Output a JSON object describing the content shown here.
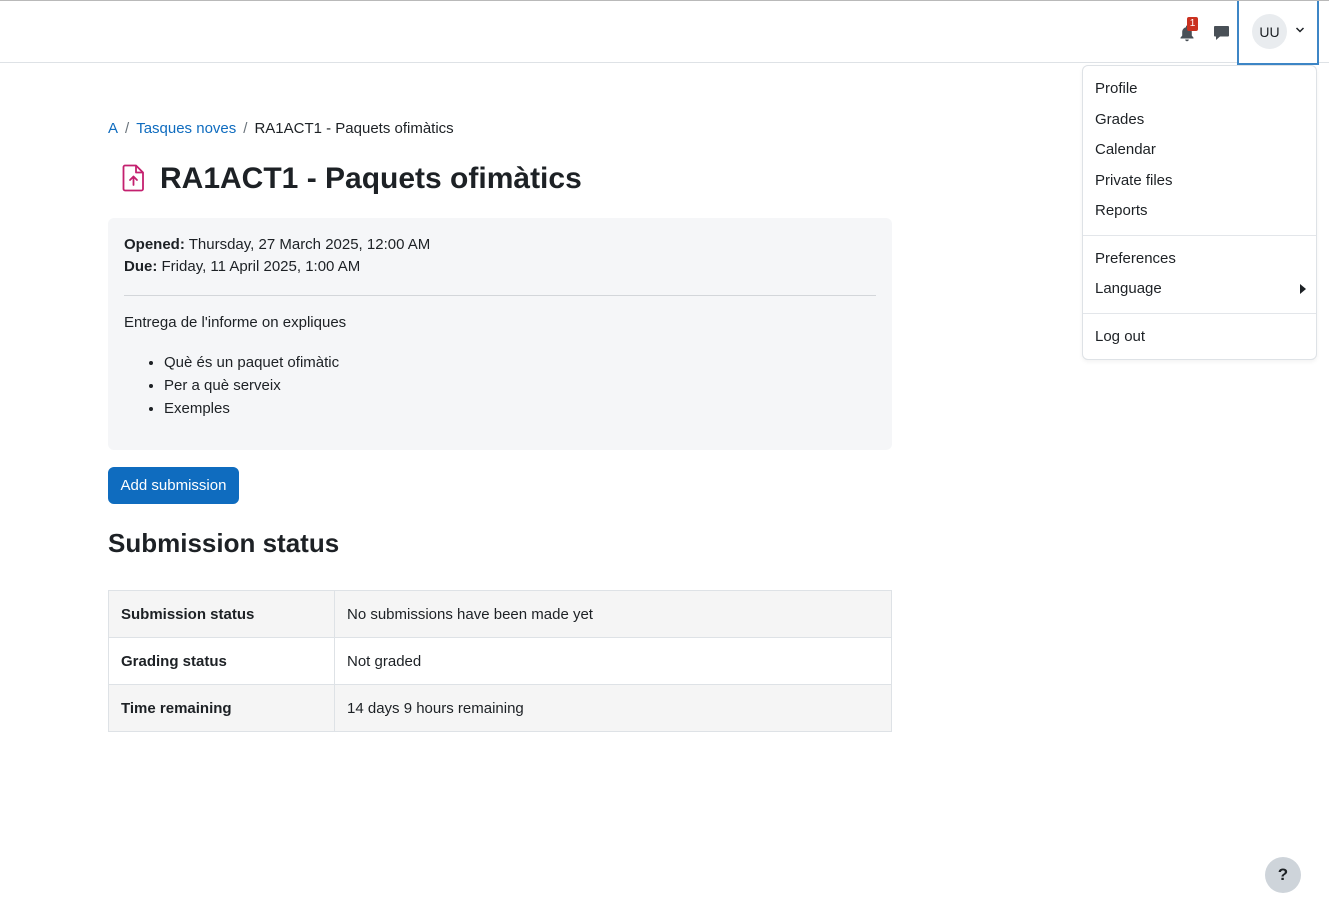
{
  "navbar": {
    "notification_count": "1",
    "user_initials": "UU",
    "icons": {
      "notifications": "bell-icon",
      "messages": "chat-bubble-icon",
      "caret": "chevron-down-icon"
    }
  },
  "user_menu": {
    "items": [
      "Profile",
      "Grades",
      "Calendar",
      "Private files",
      "Reports"
    ],
    "preferences": "Preferences",
    "language": "Language",
    "logout": "Log out"
  },
  "breadcrumb": {
    "items": [
      "A",
      "Tasques noves",
      "RA1ACT1 - Paquets ofimàtics"
    ],
    "separator": "/"
  },
  "page": {
    "title": "RA1ACT1 - Paquets ofimàtics",
    "activity_icon": "assignment-upload-icon",
    "accent_color": "#c4206f"
  },
  "dates": {
    "opened_label": "Opened:",
    "opened_value": "Thursday, 27 March 2025, 12:00 AM",
    "due_label": "Due:",
    "due_value": "Friday, 11 April 2025, 1:00 AM"
  },
  "description": {
    "intro": "Entrega de l'informe on expliques",
    "bullets": [
      "Què és un paquet ofimàtic",
      "Per a què serveix",
      "Exemples"
    ]
  },
  "actions": {
    "add_submission": "Add submission"
  },
  "submission": {
    "heading": "Submission status",
    "rows": [
      {
        "label": "Submission status",
        "value": "No submissions have been made yet"
      },
      {
        "label": "Grading status",
        "value": "Not graded"
      },
      {
        "label": "Time remaining",
        "value": "14 days 9 hours remaining"
      }
    ]
  },
  "help": {
    "label": "?"
  },
  "colors": {
    "primary": "#0f6cbf",
    "badge": "#ca3120",
    "focus_border": "#3d86c6"
  }
}
